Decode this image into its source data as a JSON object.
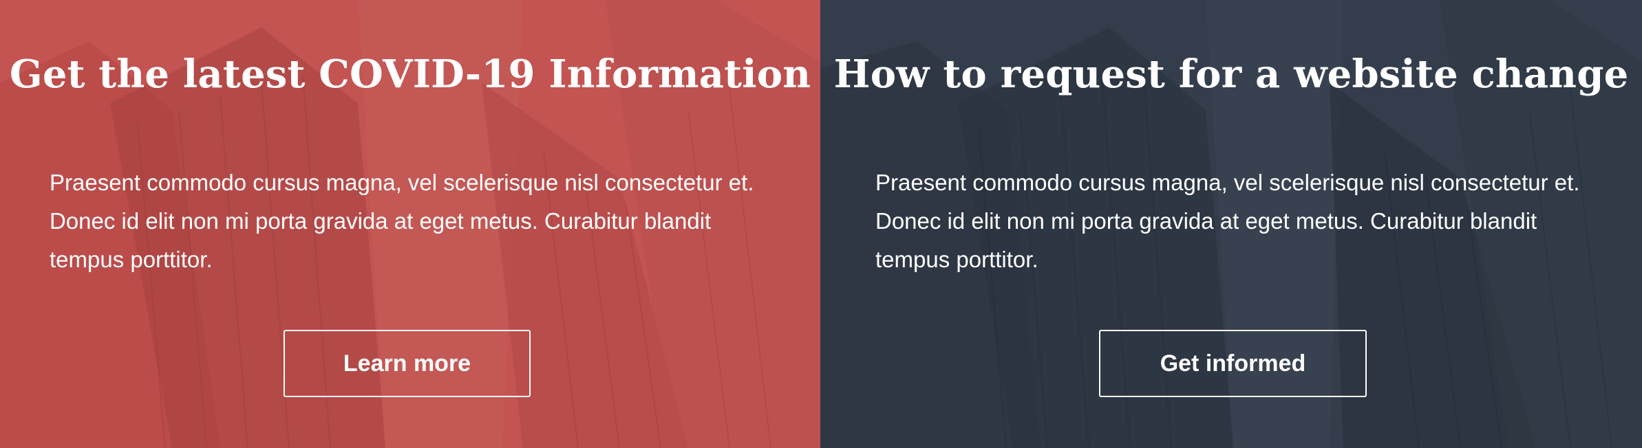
{
  "panels": [
    {
      "title": "Get the latest COVID-19 Information",
      "body": "Praesent commodo cursus magna, vel scelerisque nisl consectetur et. Donec id elit non mi porta gravida at eget metus. Curabitur blandit tempus porttitor.",
      "button_label": "Learn more",
      "overlay_color": "#c24f4d"
    },
    {
      "title": "How to request for a website change",
      "body": "Praesent commodo cursus magna, vel scelerisque nisl consectetur et. Donec id elit non mi porta gravida at eget metus. Curabitur blandit tempus porttitor.",
      "button_label": "Get informed",
      "overlay_color": "#313a48"
    }
  ]
}
